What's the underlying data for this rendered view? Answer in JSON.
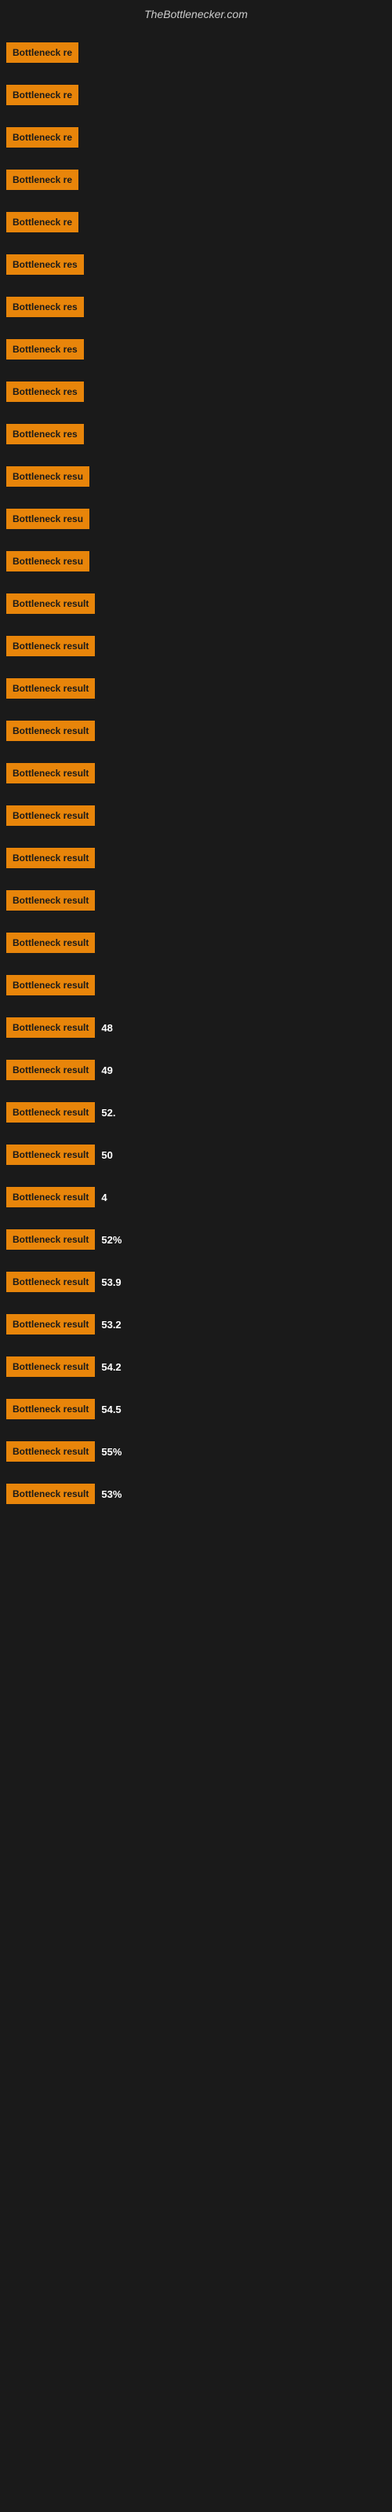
{
  "header": {
    "title": "TheBottlenecker.com"
  },
  "rows": [
    {
      "label": "Bottleneck re",
      "value": ""
    },
    {
      "label": "Bottleneck re",
      "value": ""
    },
    {
      "label": "Bottleneck re",
      "value": ""
    },
    {
      "label": "Bottleneck re",
      "value": ""
    },
    {
      "label": "Bottleneck re",
      "value": ""
    },
    {
      "label": "Bottleneck res",
      "value": ""
    },
    {
      "label": "Bottleneck res",
      "value": ""
    },
    {
      "label": "Bottleneck res",
      "value": ""
    },
    {
      "label": "Bottleneck res",
      "value": ""
    },
    {
      "label": "Bottleneck res",
      "value": ""
    },
    {
      "label": "Bottleneck resu",
      "value": ""
    },
    {
      "label": "Bottleneck resu",
      "value": ""
    },
    {
      "label": "Bottleneck resu",
      "value": ""
    },
    {
      "label": "Bottleneck result",
      "value": ""
    },
    {
      "label": "Bottleneck result",
      "value": ""
    },
    {
      "label": "Bottleneck result",
      "value": ""
    },
    {
      "label": "Bottleneck result",
      "value": ""
    },
    {
      "label": "Bottleneck result",
      "value": ""
    },
    {
      "label": "Bottleneck result",
      "value": ""
    },
    {
      "label": "Bottleneck result",
      "value": ""
    },
    {
      "label": "Bottleneck result",
      "value": ""
    },
    {
      "label": "Bottleneck result",
      "value": ""
    },
    {
      "label": "Bottleneck result",
      "value": ""
    },
    {
      "label": "Bottleneck result",
      "value": "48"
    },
    {
      "label": "Bottleneck result",
      "value": "49"
    },
    {
      "label": "Bottleneck result",
      "value": "52."
    },
    {
      "label": "Bottleneck result",
      "value": "50"
    },
    {
      "label": "Bottleneck result",
      "value": "4"
    },
    {
      "label": "Bottleneck result",
      "value": "52%"
    },
    {
      "label": "Bottleneck result",
      "value": "53.9"
    },
    {
      "label": "Bottleneck result",
      "value": "53.2"
    },
    {
      "label": "Bottleneck result",
      "value": "54.2"
    },
    {
      "label": "Bottleneck result",
      "value": "54.5"
    },
    {
      "label": "Bottleneck result",
      "value": "55%"
    },
    {
      "label": "Bottleneck result",
      "value": "53%"
    }
  ]
}
